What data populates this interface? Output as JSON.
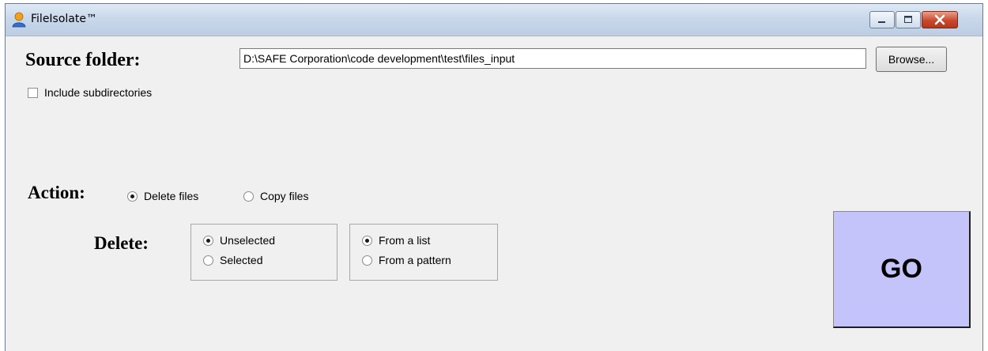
{
  "window": {
    "title": "FileIsolate™",
    "app_icon": "person-icon"
  },
  "source": {
    "label": "Source folder:",
    "path": "D:\\SAFE Corporation\\code development\\test\\files_input",
    "browse_label": "Browse...",
    "include_subdirs_label": "Include subdirectories",
    "include_subdirs_checked": false
  },
  "action": {
    "label": "Action:",
    "options": [
      {
        "label": "Delete files",
        "selected": true
      },
      {
        "label": "Copy files",
        "selected": false
      }
    ]
  },
  "delete": {
    "label": "Delete:",
    "selection_group": [
      {
        "label": "Unselected",
        "selected": true
      },
      {
        "label": "Selected",
        "selected": false
      }
    ],
    "source_group": [
      {
        "label": "From a list",
        "selected": true
      },
      {
        "label": "From a pattern",
        "selected": false
      }
    ]
  },
  "go": {
    "label": "GO",
    "color": "#c4c4fb"
  }
}
